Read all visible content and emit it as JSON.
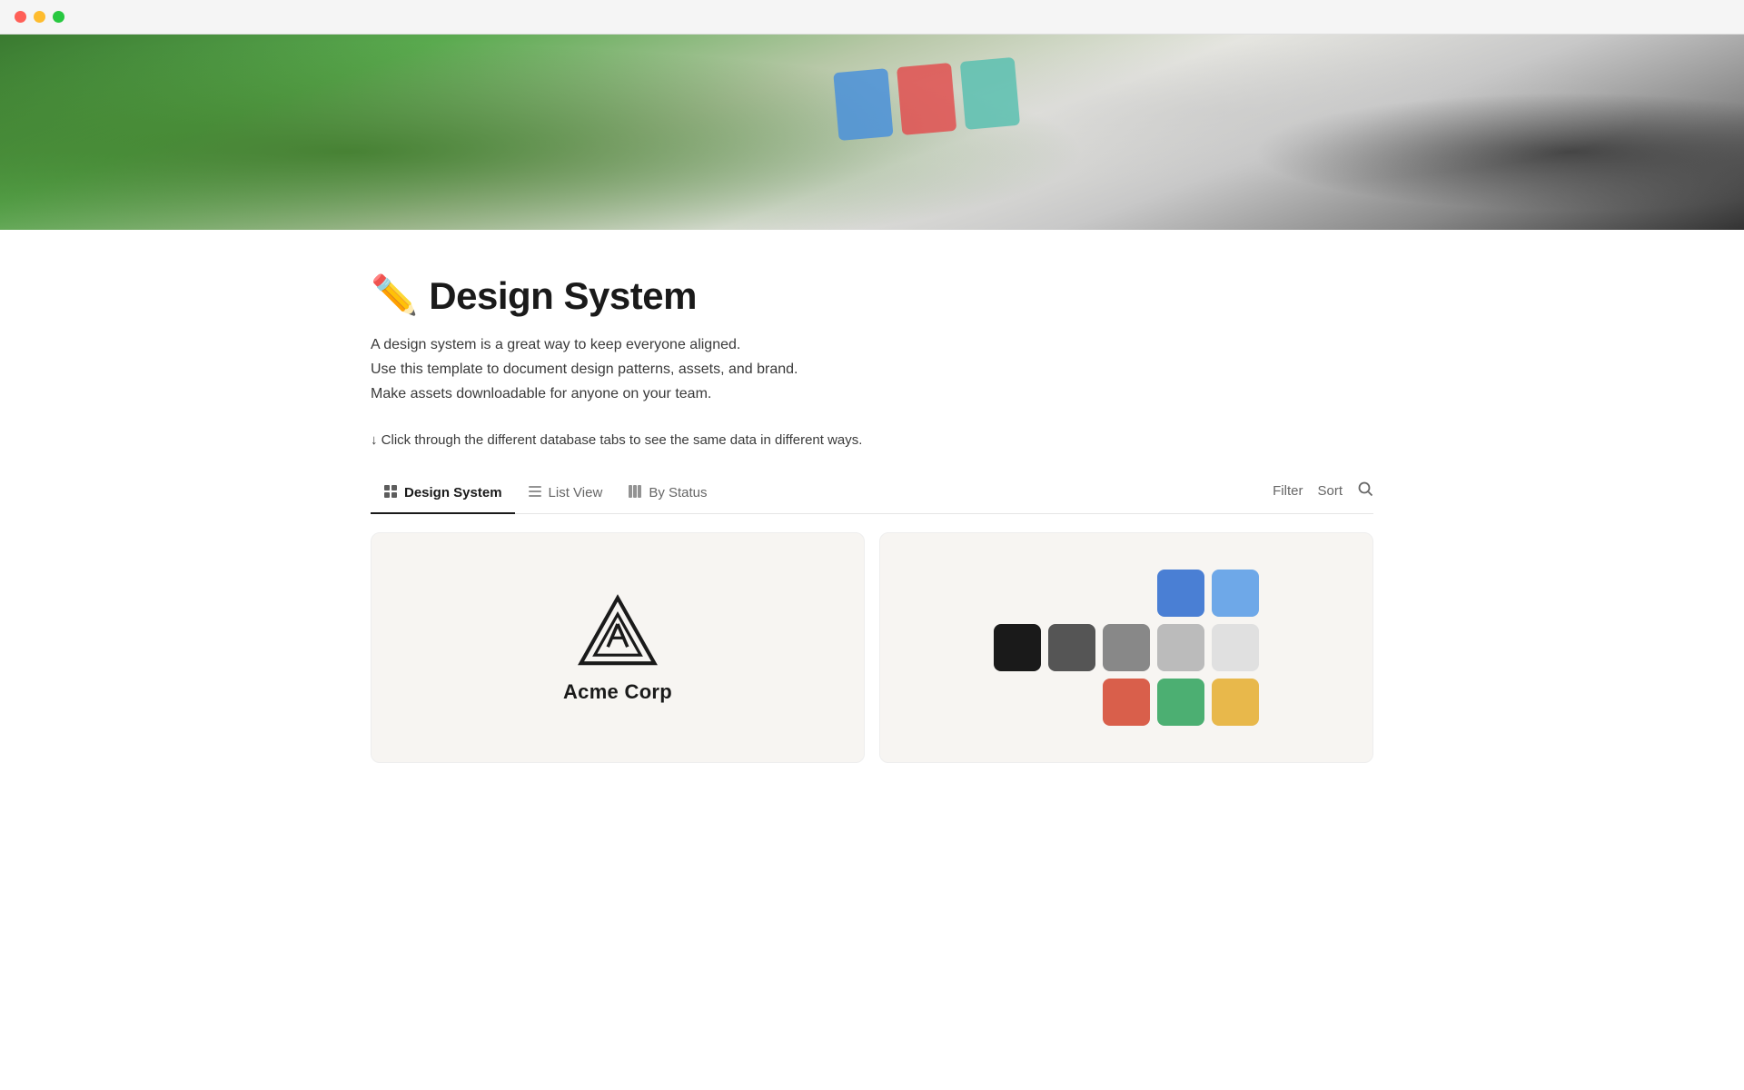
{
  "titlebar": {
    "traffic_lights": [
      "red",
      "yellow",
      "green"
    ]
  },
  "hero": {
    "alt": "Design workspace with plants and laptop"
  },
  "page": {
    "emoji": "✏️",
    "title": "Design System",
    "description_lines": [
      "A design system is a great way to keep everyone aligned.",
      "Use this template to document design patterns, assets, and brand.",
      "Make assets downloadable for anyone on your team."
    ],
    "hint": "↓ Click through the different database tabs to see the same data in different ways."
  },
  "tabs": [
    {
      "id": "design-system",
      "icon": "grid",
      "label": "Design System",
      "active": true
    },
    {
      "id": "list-view",
      "icon": "list",
      "label": "List View",
      "active": false
    },
    {
      "id": "by-status",
      "icon": "columns",
      "label": "By Status",
      "active": false
    }
  ],
  "tab_actions": {
    "filter_label": "Filter",
    "sort_label": "Sort"
  },
  "cards": [
    {
      "id": "acme-corp",
      "type": "logo",
      "company_name": "Acme Corp"
    },
    {
      "id": "color-palette",
      "type": "swatches",
      "rows": [
        [
          "#4a7fd4",
          "#6ea8e8"
        ],
        [
          "#1a1a1a",
          "#555555",
          "#888888",
          "#bbbbbb",
          "#e0e0e0"
        ],
        [
          "#d95f4b",
          "#4caf72",
          "#e8b84b"
        ]
      ]
    }
  ],
  "icons": {
    "grid": "⊞",
    "list": "≡",
    "columns": "⊟",
    "search": "🔍",
    "filter": "Filter",
    "sort": "Sort"
  }
}
